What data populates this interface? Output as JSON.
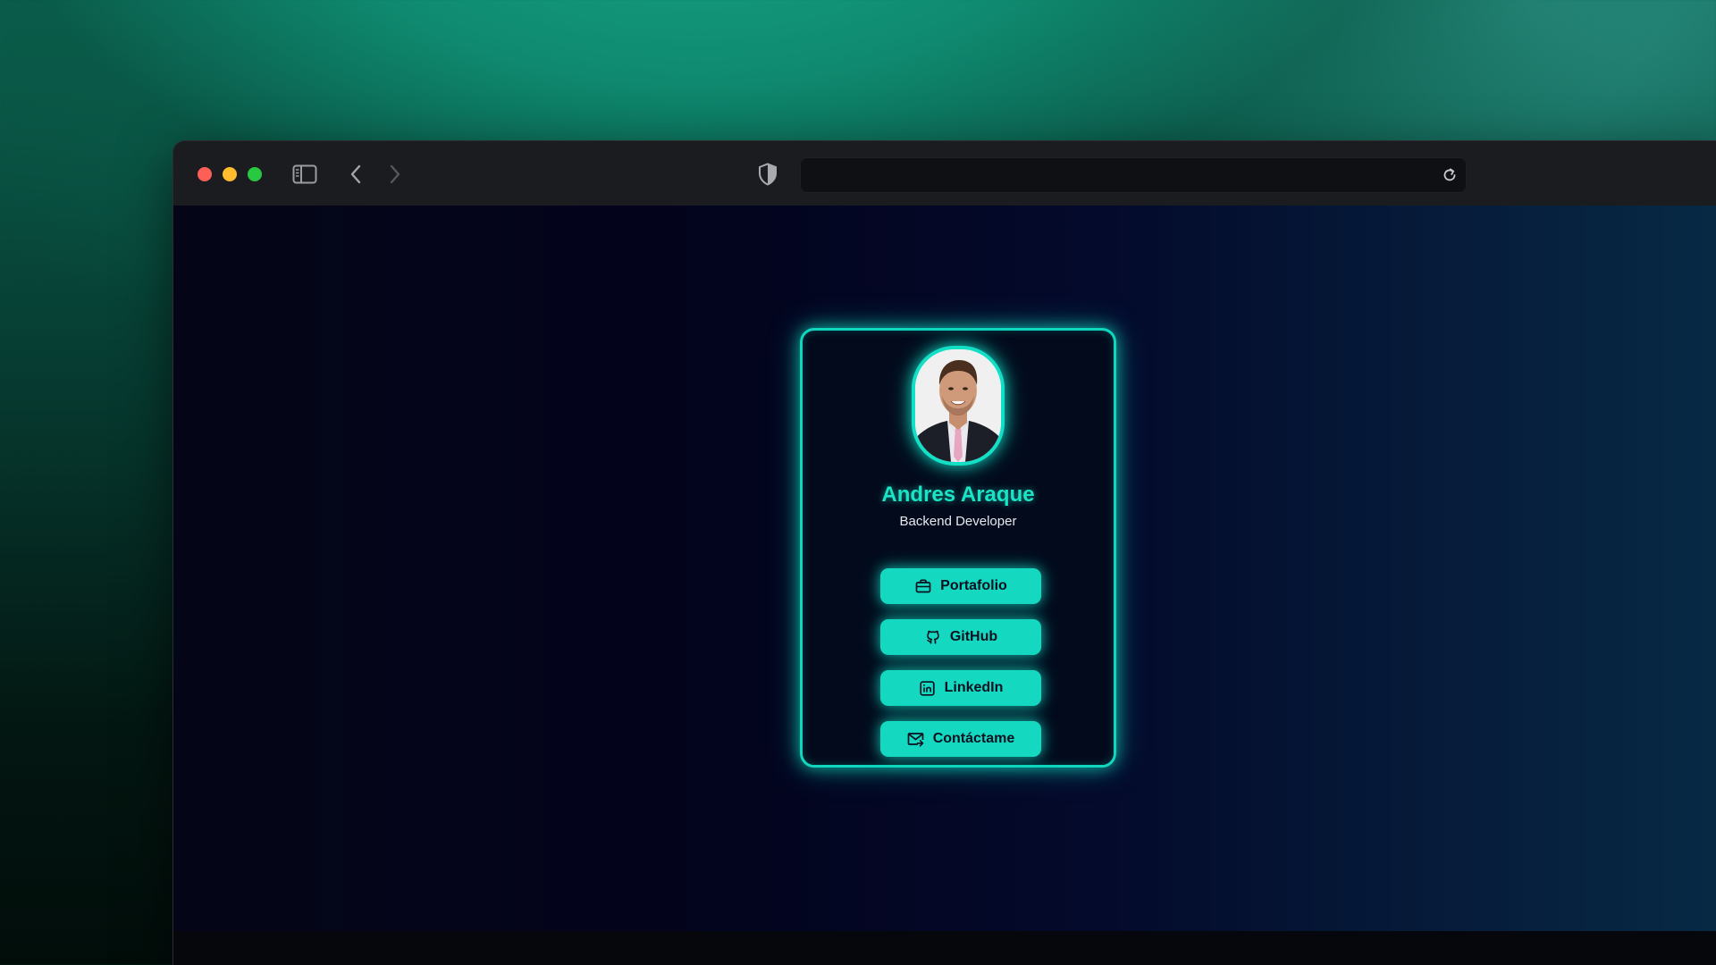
{
  "browser": {
    "address_value": "",
    "icons": {
      "sidebar": "sidebar-toggle-icon",
      "back": "chevron-left-icon",
      "forward": "chevron-right-icon",
      "privacy": "shield-icon",
      "reload": "reload-icon"
    }
  },
  "profile": {
    "name": "Andres Araque",
    "role": "Backend Developer",
    "avatar": "profile-photo"
  },
  "links": [
    {
      "label": "Portafolio",
      "icon": "briefcase-icon"
    },
    {
      "label": "GitHub",
      "icon": "github-icon"
    },
    {
      "label": "LinkedIn",
      "icon": "linkedin-icon"
    },
    {
      "label": "Contáctame",
      "icon": "mail-icon"
    }
  ],
  "colors": {
    "accent": "#15d8c0",
    "name_text": "#19e4c6",
    "card_bg": "#030a1c",
    "traffic_red": "#fe5f57",
    "traffic_yellow": "#febc2e",
    "traffic_green": "#28c840"
  }
}
